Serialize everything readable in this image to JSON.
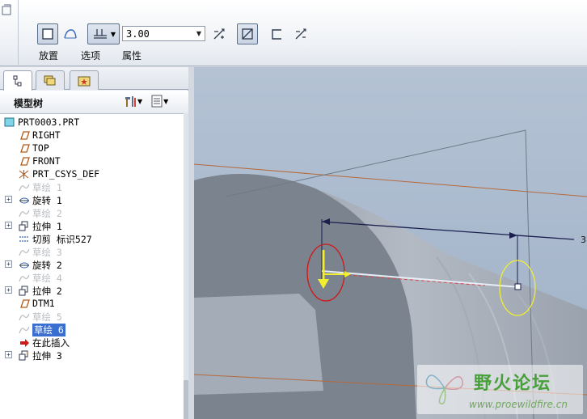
{
  "dashboard": {
    "tabs": [
      "放置",
      "选项",
      "属性"
    ],
    "depth_value": "3.00",
    "buttons": [
      "solid-button",
      "surface-button",
      "depth-option-button",
      "flip-direction-button",
      "remove-material-button",
      "thicken-button",
      "flip-thicken-button"
    ]
  },
  "panel": {
    "tabs": [
      "model-tree-tab",
      "layer-tree-tab",
      "favorites-tab"
    ],
    "title": "模型树",
    "tree": [
      {
        "label": "PRT0003.PRT",
        "icon": "part-icon",
        "expand": false,
        "state": "normal",
        "indent": 0
      },
      {
        "label": "RIGHT",
        "icon": "datum-plane-icon",
        "expand": false,
        "state": "normal",
        "indent": 1
      },
      {
        "label": "TOP",
        "icon": "datum-plane-icon",
        "expand": false,
        "state": "normal",
        "indent": 1
      },
      {
        "label": "FRONT",
        "icon": "datum-plane-icon",
        "expand": false,
        "state": "normal",
        "indent": 1
      },
      {
        "label": "PRT_CSYS_DEF",
        "icon": "coordinate-system-icon",
        "expand": false,
        "state": "normal",
        "indent": 1
      },
      {
        "label": "草绘 1",
        "icon": "sketch-icon",
        "expand": false,
        "state": "dim",
        "indent": 1
      },
      {
        "label": "旋转 1",
        "icon": "revolve-icon",
        "expand": true,
        "state": "normal",
        "indent": 1
      },
      {
        "label": "草绘 2",
        "icon": "sketch-icon",
        "expand": false,
        "state": "dim",
        "indent": 1
      },
      {
        "label": "拉伸 1",
        "icon": "extrude-icon",
        "expand": true,
        "state": "normal",
        "indent": 1
      },
      {
        "label": "切剪 标识527",
        "icon": "cut-icon",
        "expand": false,
        "state": "normal",
        "indent": 1
      },
      {
        "label": "草绘 3",
        "icon": "sketch-icon",
        "expand": false,
        "state": "dim",
        "indent": 1
      },
      {
        "label": "旋转 2",
        "icon": "revolve-icon",
        "expand": true,
        "state": "normal",
        "indent": 1
      },
      {
        "label": "草绘 4",
        "icon": "sketch-icon",
        "expand": false,
        "state": "dim",
        "indent": 1
      },
      {
        "label": "拉伸 2",
        "icon": "extrude-icon",
        "expand": true,
        "state": "normal",
        "indent": 1
      },
      {
        "label": "DTM1",
        "icon": "datum-plane-icon",
        "expand": false,
        "state": "normal",
        "indent": 1
      },
      {
        "label": "草绘 5",
        "icon": "sketch-icon",
        "expand": false,
        "state": "dim",
        "indent": 1
      },
      {
        "label": "草绘 6",
        "icon": "sketch-icon",
        "expand": false,
        "state": "selected",
        "indent": 1
      },
      {
        "label": "在此插入",
        "icon": "insert-here-arrow-icon",
        "expand": false,
        "state": "normal",
        "indent": 1
      },
      {
        "label": "拉伸 3",
        "icon": "extrude-new-icon",
        "expand": true,
        "state": "normal",
        "indent": 1
      }
    ]
  },
  "graphics": {
    "dimension_label": "3",
    "watermark_title": "野火论坛",
    "watermark_url": "www.proewildfire.cn"
  },
  "colors": {
    "background": "#aab9cc",
    "part_body": "#7b838f",
    "part_highlight": "#a7afba",
    "selection_red": "#d01818",
    "selection_yellow": "#f2ee30",
    "sketch_line": "#1a1f4e",
    "datum_orange": "#b56a3c"
  }
}
